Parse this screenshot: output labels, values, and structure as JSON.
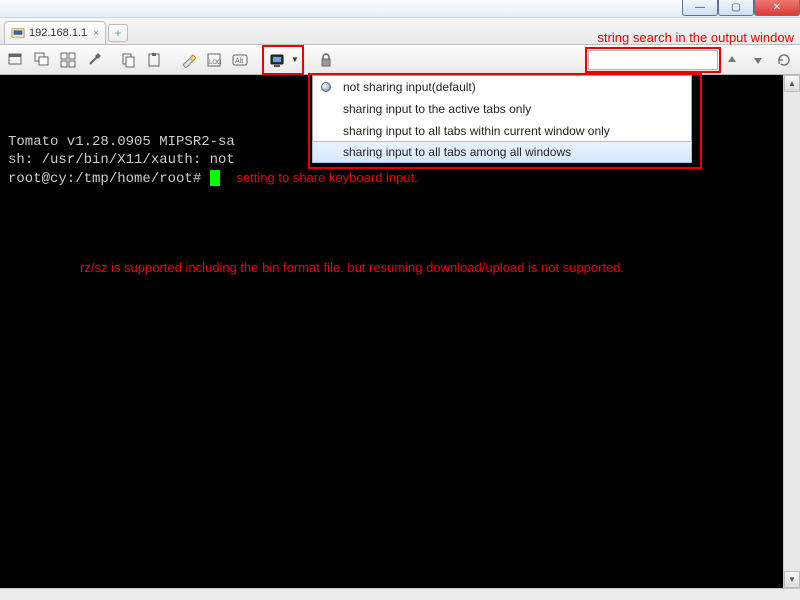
{
  "window": {
    "min_label": "—",
    "max_label": "▢",
    "close_label": "✕"
  },
  "tab": {
    "title": "192.168.1.1",
    "close": "×"
  },
  "newtab_glyph": "+",
  "toolbar": {
    "search_placeholder": ""
  },
  "dropdown": {
    "items": [
      "not sharing input(default)",
      "sharing input to the active tabs only",
      "sharing input to all tabs within current window only",
      "sharing input to all tabs among all windows"
    ],
    "selected_index": 0,
    "highlight_index": 3
  },
  "annotations": {
    "search_label": "string search in the output window",
    "share_label": "setting to share keyboard input.",
    "rzsz": "rz/sz is supported including the bin format file. but resuming download/upload is not supported."
  },
  "terminal": {
    "lines": [
      "",
      "",
      "Tomato v1.28.0905 MIPSR2-sa",
      "sh: /usr/bin/X11/xauth: not",
      "root@cy:/tmp/home/root# "
    ]
  },
  "colors": {
    "annotation": "#ee0000",
    "cursor": "#00ff00"
  }
}
